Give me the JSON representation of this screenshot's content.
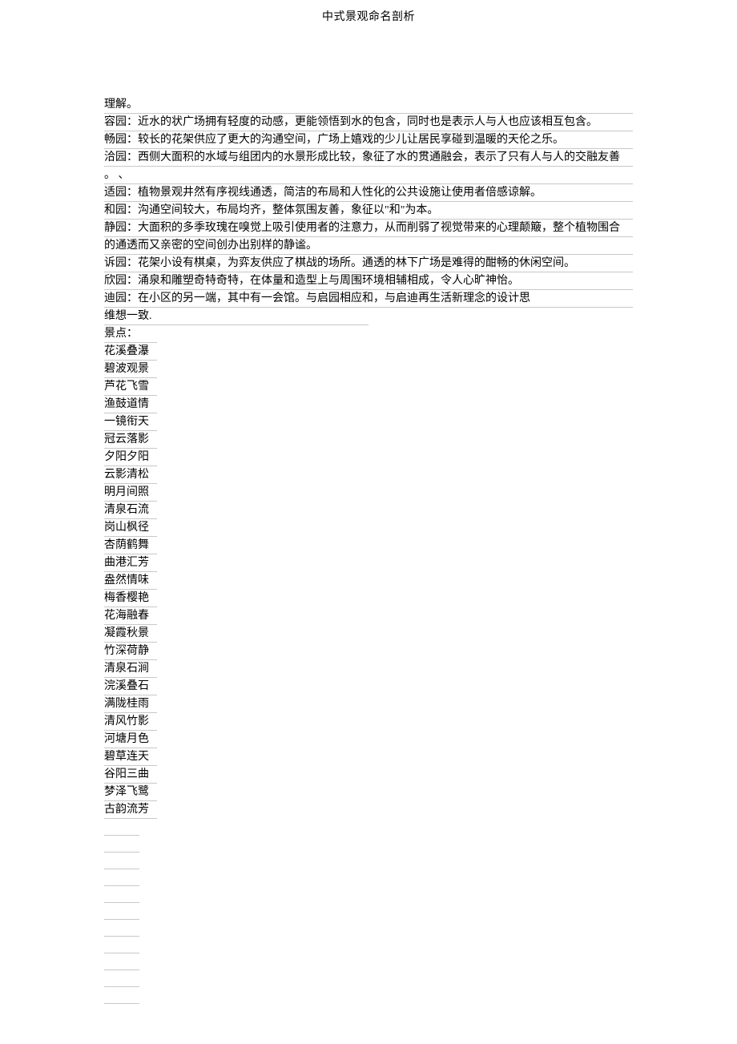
{
  "header": {
    "title": "中式景观命名剖析"
  },
  "paragraphs": [
    "理解。",
    "容园：近水的状广场拥有轻度的动感，更能领悟到水的包含，同时也是表示人与人也应该相互包含。",
    "畅园：较长的花架供应了更大的沟通空间，广场上嬉戏的少儿让居民享碰到温暖的天伦之乐。",
    "洽园：西侧大面积的水域与组团内的水景形成比较，象征了水的贯通融会，表示了只有人与人的交融友善",
    "。  、",
    "适园：植物景观井然有序视线通透，简洁的布局和人性化的公共设施让使用者倍感谅解。",
    "和园：沟通空间较大，布局均齐，整体氛围友善，象征以\"和\"为本。",
    "静园：大面积的多季玫瑰在嗅觉上吸引使用者的注意力，从而削弱了视觉带来的心理颠簸，整个植物围合",
    "的通透而又亲密的空间创办出别样的静谧。",
    "诉园：花架小设有棋桌，为弈友供应了棋战的场所。通透的林下广场是难得的酣畅的休闲空间。",
    "欣园：涌泉和雕塑奇特奇特，在体量和造型上与周围环境相辅相成，令人心旷神怡。",
    "迪园：在小区的另一端，其中有一会馆。与启园相应和，与启迪再生活新理念的设计思"
  ],
  "half_line": "维想一致.",
  "scenic": {
    "label": "景点：",
    "items": [
      "花溪叠瀑",
      "碧波观景",
      "芦花飞雪",
      "渔鼓道情",
      "一镜衔天",
      "冠云落影",
      "夕阳夕阳",
      "云影清松",
      "明月间照",
      "清泉石流",
      "岗山枫径",
      "杏荫鹤舞",
      "曲港汇芳",
      "盎然情味",
      "梅香樱艳",
      "花海融春",
      "凝霞秋景",
      "竹深荷静",
      "清泉石涧",
      "浣溪叠石",
      "满陇桂雨",
      "清风竹影",
      "河塘月色",
      "碧草连天",
      "谷阳三曲",
      "梦泽飞鹭",
      "古韵流芳"
    ]
  },
  "trailing_empty_rows": 11
}
